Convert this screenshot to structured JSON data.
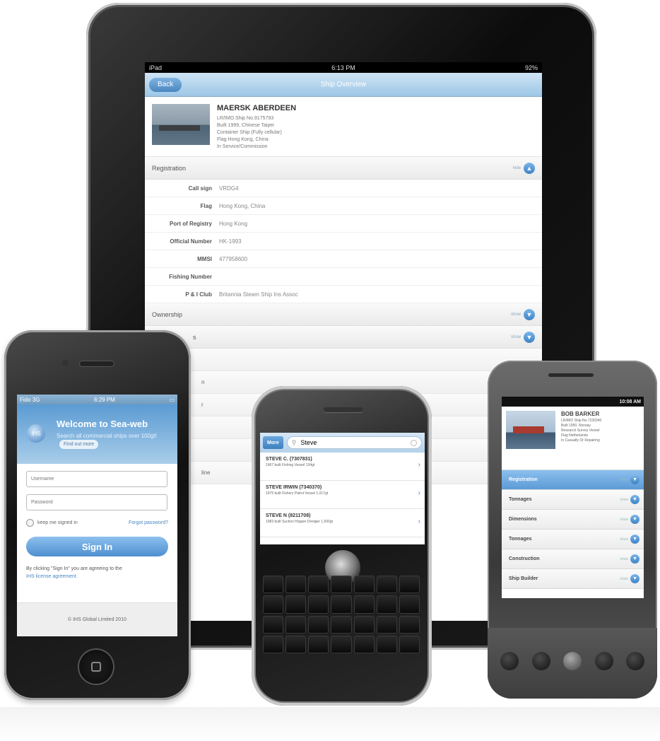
{
  "ipad": {
    "status": {
      "carrier": "iPad",
      "time": "6:13 PM",
      "battery": "92%"
    },
    "nav": {
      "back": "Back",
      "title": "Ship Overview"
    },
    "ship": {
      "name": "MAERSK ABERDEEN",
      "lines": [
        "LR/IMO Ship No.9175793",
        "Built 1999, Chinese Taipei",
        "Container Ship (Fully cellular)",
        "Flag Hong Kong, China",
        "In Service/Commission"
      ]
    },
    "registration": {
      "title": "Registration",
      "toggle": "hide",
      "rows": [
        {
          "label": "Call sign",
          "value": "VRDG4"
        },
        {
          "label": "Flag",
          "value": "Hong Kong, China"
        },
        {
          "label": "Port of Registry",
          "value": "Hong Kong"
        },
        {
          "label": "Official Number",
          "value": "HK-1993"
        },
        {
          "label": "MMSI",
          "value": "477958600"
        },
        {
          "label": "Fishing Number",
          "value": ""
        },
        {
          "label": "P & I Club",
          "value": "Britannia Steam Ship Ins Assoc"
        }
      ]
    },
    "sections": [
      {
        "title": "Ownership",
        "toggle": "show"
      },
      {
        "title": "s",
        "toggle": "show"
      },
      {
        "title": "",
        "toggle": ""
      },
      {
        "title": "n",
        "toggle": ""
      },
      {
        "title": "r",
        "toggle": ""
      },
      {
        "title": "",
        "toggle": ""
      },
      {
        "title": "",
        "toggle": ""
      },
      {
        "title": "line",
        "toggle": ""
      }
    ]
  },
  "iphone": {
    "status": {
      "carrier": "Fido",
      "network": "3G",
      "time": "6:29 PM"
    },
    "logo": "IHS",
    "welcome": "Welcome to Sea-web",
    "search_text": "Search all commercial ships over 100gt!",
    "find_out": "Find out more",
    "username_placeholder": "Username",
    "password_placeholder": "Password",
    "keep_signed": "keep me signed in",
    "forgot": "Forgot password?",
    "signin": "Sign In",
    "terms_prefix": "By clicking \"Sign In\" you are agreeing to the",
    "terms_link": "IHS license agreement.",
    "footer": "© IHS Global Limited 2010"
  },
  "blackberry": {
    "more": "More",
    "search_value": "Steve",
    "results": [
      {
        "title": "STEVE C. (7307831)",
        "sub": "1967 built Fishing Vessel 134gt"
      },
      {
        "title": "STEVE IRWIN (7340370)",
        "sub": "1975 built Fishery Patrol Vessel 1,017gt"
      },
      {
        "title": "STEVE N (8211708)",
        "sub": "1983 built Suction Hopper Dredger 1,500gt"
      }
    ]
  },
  "android": {
    "time": "10:08 AM",
    "ship": {
      "name": "BOB BARKER",
      "lines": [
        "LR/IMO Ship No.7230340",
        "Built 1950, Norway",
        "Research Survey Vessel",
        "Flag Netherlands",
        "In Casualty Or Repairing"
      ]
    },
    "rows": [
      {
        "label": "Registration",
        "toggle": "show",
        "active": true
      },
      {
        "label": "Tonnages",
        "toggle": "show",
        "active": false
      },
      {
        "label": "Dimensions",
        "toggle": "show",
        "active": false
      },
      {
        "label": "Tonnages",
        "toggle": "show",
        "active": false
      },
      {
        "label": "Construction",
        "toggle": "show",
        "active": false
      },
      {
        "label": "Ship Builder",
        "toggle": "show",
        "active": false
      }
    ]
  }
}
